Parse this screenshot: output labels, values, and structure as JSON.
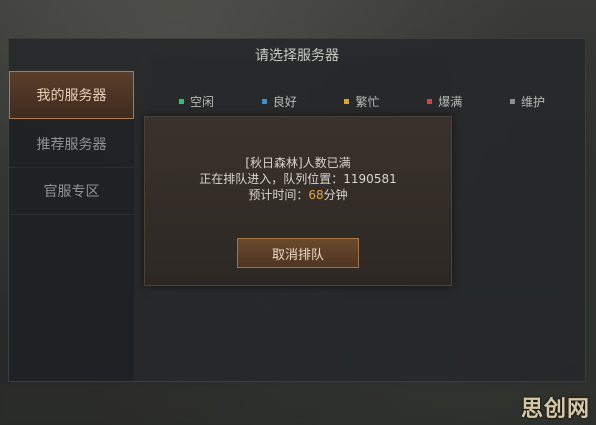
{
  "window": {
    "title": "请选择服务器"
  },
  "sidebar": {
    "items": [
      {
        "label": "我的服务器",
        "active": true
      },
      {
        "label": "推荐服务器",
        "active": false
      },
      {
        "label": "官服专区",
        "active": false
      }
    ]
  },
  "legend": [
    {
      "label": "空闲",
      "color": "#2fbf71"
    },
    {
      "label": "良好",
      "color": "#3a8fd6"
    },
    {
      "label": "繁忙",
      "color": "#d9a23a"
    },
    {
      "label": "爆满",
      "color": "#d9413a"
    },
    {
      "label": "维护",
      "color": "#8e8e8e"
    }
  ],
  "dialog": {
    "line1": "[秋日森林]人数已满",
    "line2_prefix": "正在排队进入，队列位置：",
    "queue_position": "1190581",
    "line3_prefix": "预计时间：",
    "eta_minutes": "68",
    "line3_suffix": "分钟",
    "cancel_label": "取消排队"
  },
  "watermark": "思创网"
}
